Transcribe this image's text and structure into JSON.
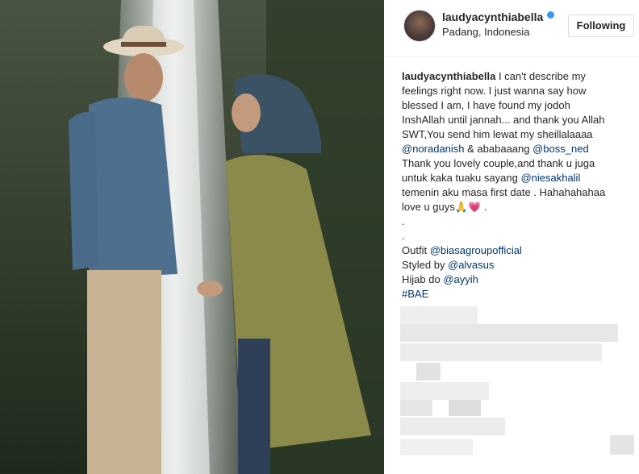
{
  "post": {
    "username": "laudyacynthiabella",
    "location": "Padang, Indonesia",
    "follow_label": "Following"
  },
  "caption": {
    "username": "laudyacynthiabella",
    "line1": " I can't describe my",
    "line2": "feelings right now. I just wanna say how",
    "line3": "blessed I am, I have found my jodoh",
    "line4": "InshAllah until jannah... and thank you Allah",
    "line5": "SWT,You send him lewat my sheillalaaaa",
    "mention_noradanish": "@noradanish",
    "line6_mid": " & ababaaang ",
    "mention_boss_ned": "@boss_ned",
    "line7": "Thank you lovely couple,and thank u juga",
    "line8_pre": "untuk kaka tuaku sayang ",
    "mention_niesakhalil": "@niesakhalil",
    "line9": "temenin aku masa first date . Hahahahahaa",
    "line10": "love u guys🙏💗 .",
    "dot1": ".",
    "dot2": ".",
    "outfit_label": "Outfit ",
    "outfit_mention": "@biasagroupofficial",
    "styled_label": "Styled by ",
    "styled_mention": "@alvasus",
    "hijab_label": "Hijab do ",
    "hijab_mention": "@ayyih",
    "hashtag": "#BAE"
  },
  "colors": {
    "link": "#003569",
    "verified": "#3897f0",
    "text": "#262626"
  },
  "icons": {
    "verified": "verified-badge-icon"
  }
}
